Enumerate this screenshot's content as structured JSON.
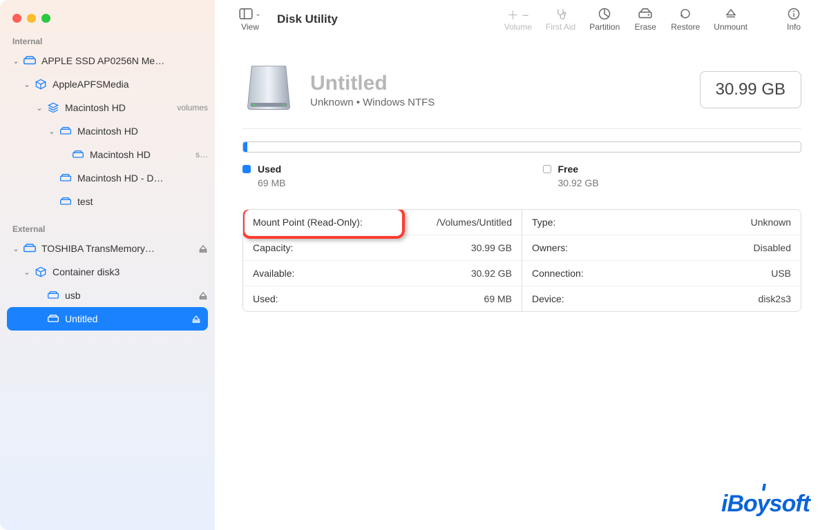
{
  "app": {
    "title": "Disk Utility"
  },
  "toolbar": {
    "view": "View",
    "volume": "Volume",
    "firstaid": "First Aid",
    "partition": "Partition",
    "erase": "Erase",
    "restore": "Restore",
    "unmount": "Unmount",
    "info": "Info"
  },
  "sidebar": {
    "internal_label": "Internal",
    "external_label": "External",
    "internal": [
      {
        "label": "APPLE SSD AP0256N Me…",
        "icon": "hdd"
      },
      {
        "label": "AppleAPFSMedia",
        "icon": "cube"
      },
      {
        "label": "Macintosh HD",
        "suffix": "volumes",
        "icon": "stack"
      },
      {
        "label": "Macintosh HD",
        "icon": "hdd-sm"
      },
      {
        "label": "Macintosh HD",
        "suffix": "s…",
        "icon": "hdd-sm"
      },
      {
        "label": "Macintosh HD - D…",
        "icon": "hdd-sm"
      },
      {
        "label": "test",
        "icon": "hdd-sm"
      }
    ],
    "external": [
      {
        "label": "TOSHIBA TransMemory…",
        "icon": "hdd-ext"
      },
      {
        "label": "Container disk3",
        "icon": "cube"
      },
      {
        "label": "usb",
        "icon": "hdd-sm"
      },
      {
        "label": "Untitled",
        "icon": "hdd-ext-sel",
        "selected": true
      }
    ]
  },
  "volume": {
    "name": "Untitled",
    "subtitle": "Unknown  •  Windows NTFS",
    "size": "30.99 GB"
  },
  "usage": {
    "used_label": "Used",
    "used_value": "69 MB",
    "free_label": "Free",
    "free_value": "30.92 GB"
  },
  "info": {
    "left": [
      {
        "k": "Mount Point (Read-Only):",
        "v": "/Volumes/Untitled"
      },
      {
        "k": "Capacity:",
        "v": "30.99 GB"
      },
      {
        "k": "Available:",
        "v": "30.92 GB"
      },
      {
        "k": "Used:",
        "v": "69 MB"
      }
    ],
    "right": [
      {
        "k": "Type:",
        "v": "Unknown"
      },
      {
        "k": "Owners:",
        "v": "Disabled"
      },
      {
        "k": "Connection:",
        "v": "USB"
      },
      {
        "k": "Device:",
        "v": "disk2s3"
      }
    ]
  },
  "watermark": "iBoysoft"
}
